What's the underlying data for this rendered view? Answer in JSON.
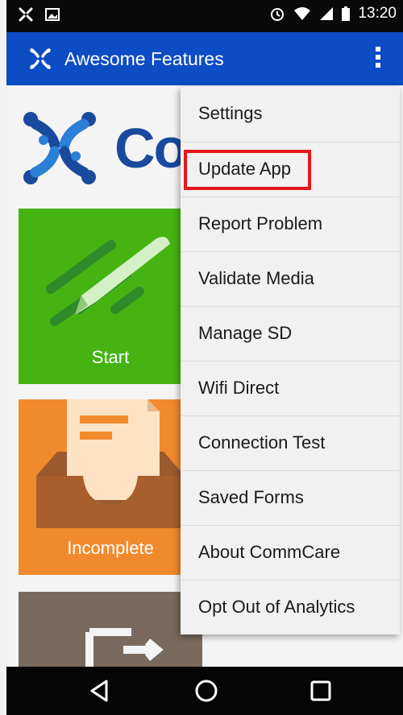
{
  "status_bar": {
    "time": "13:20",
    "icons": [
      "app-notification-icon",
      "image-notification-icon",
      "alarm-icon",
      "wifi-icon",
      "signal-icon",
      "battery-icon"
    ]
  },
  "app_bar": {
    "title": "Awesome Features",
    "logo_icon": "app-logo-icon",
    "overflow_icon": "overflow-menu-icon",
    "color": "#0c4cc4"
  },
  "content": {
    "brand_text": "Co",
    "tiles": [
      {
        "label": "Start",
        "color": "#45b413",
        "icon": "pencil-icon"
      },
      {
        "label": "Incomplete",
        "color": "#f18a2d",
        "icon": "inbox-tray-icon"
      },
      {
        "label": "",
        "color": "#786a5d",
        "icon": "sync-forms-icon"
      }
    ]
  },
  "menu": {
    "items": [
      {
        "label": "Settings"
      },
      {
        "label": "Update App"
      },
      {
        "label": "Report Problem"
      },
      {
        "label": "Validate Media"
      },
      {
        "label": "Manage SD"
      },
      {
        "label": "Wifi Direct"
      },
      {
        "label": "Connection Test"
      },
      {
        "label": "Saved Forms"
      },
      {
        "label": "About CommCare"
      },
      {
        "label": "Opt Out of Analytics"
      }
    ],
    "highlight_color": "#e8151c"
  },
  "nav_bar": {
    "buttons": [
      "back-icon",
      "home-icon",
      "recents-icon"
    ]
  }
}
